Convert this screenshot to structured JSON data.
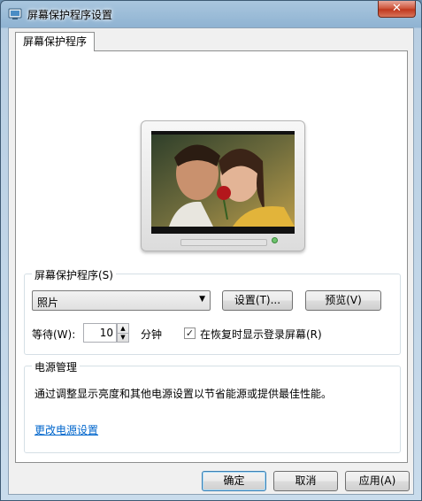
{
  "window": {
    "title": "屏幕保护程序设置",
    "close_glyph": "✕"
  },
  "tab": {
    "label": "屏幕保护程序"
  },
  "screensaver": {
    "group_label": "屏幕保护程序(S)",
    "selected": "照片",
    "settings_label": "设置(T)...",
    "preview_label": "预览(V)",
    "wait_label": "等待(W):",
    "wait_value": "10",
    "wait_unit": "分钟",
    "resume_checked": true,
    "resume_label": "在恢复时显示登录屏幕(R)"
  },
  "power": {
    "group_label": "电源管理",
    "description": "通过调整显示亮度和其他电源设置以节省能源或提供最佳性能。",
    "link_label": "更改电源设置"
  },
  "footer": {
    "ok_label": "确定",
    "cancel_label": "取消",
    "apply_label": "应用(A)"
  },
  "colors": {
    "link": "#0066cc",
    "title_bar": "#8fb3d2",
    "close_button": "#c0391f"
  },
  "icons": [
    "screensaver-app-icon",
    "close-icon",
    "chevron-down-icon",
    "spin-up-icon",
    "spin-down-icon",
    "checkmark-icon"
  ]
}
